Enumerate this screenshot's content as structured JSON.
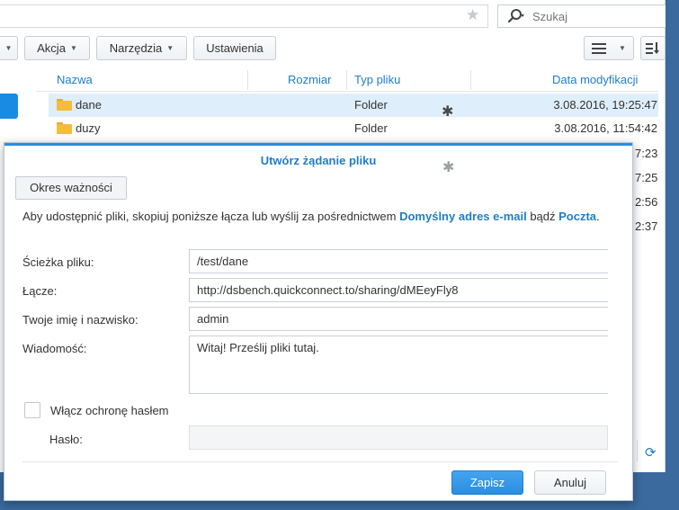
{
  "search": {
    "placeholder": "Szukaj"
  },
  "toolbar": {
    "action_label": "Akcja",
    "tools_label": "Narzędzia",
    "settings_label": "Ustawienia"
  },
  "columns": {
    "name": "Nazwa",
    "size": "Rozmiar",
    "type": "Typ pliku",
    "modified": "Data modyfikacji"
  },
  "files": [
    {
      "name": "dane",
      "type": "Folder",
      "modified": "3.08.2016, 19:25:47",
      "selected": true
    },
    {
      "name": "duzy",
      "type": "Folder",
      "modified": "3.08.2016, 11:54:42",
      "selected": false
    }
  ],
  "partial_dates": [
    "7:23",
    "7:25",
    "2:56",
    "2:37"
  ],
  "dialog": {
    "title": "Utwórz żądanie pliku",
    "tab_label": "Okres ważności",
    "description_prefix": "Aby udostępnić pliki, skopiuj poniższe łącza lub wyślij za pośrednictwem ",
    "link_email": "Domyślny adres e-mail",
    "description_mid": " bądź ",
    "link_mail": "Poczta",
    "description_suffix": ".",
    "fields": {
      "path_label": "Ścieżka pliku:",
      "path_value": "/test/dane",
      "link_label": "Łącze:",
      "link_value": "http://dsbench.quickconnect.to/sharing/dMEeyFly8",
      "name_label": "Twoje imię i nazwisko:",
      "name_value": "admin",
      "message_label": "Wiadomość:",
      "message_value": "Witaj! Prześlij pliki tutaj."
    },
    "password_toggle_label": "Włącz ochronę hasłem",
    "password_label": "Hasło:",
    "password_value": "",
    "save_label": "Zapisz",
    "cancel_label": "Anuluj"
  },
  "colors": {
    "accent": "#1f7ec9",
    "primary_button": "#2b8ee0",
    "selected_row": "#dfeefb",
    "folder": "#f4bb3d"
  },
  "icons": [
    "star-icon",
    "search-icon",
    "list-view-icon",
    "sort-icon",
    "folder-icon",
    "refresh-icon"
  ]
}
